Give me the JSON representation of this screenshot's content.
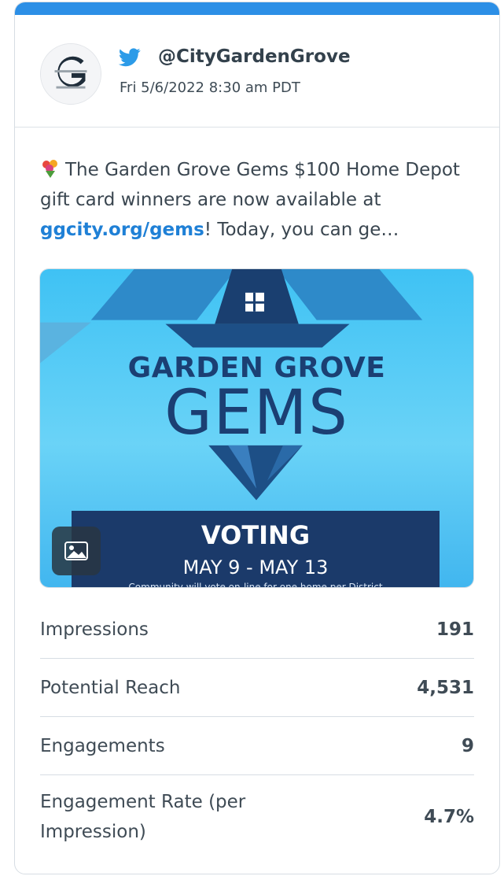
{
  "post": {
    "handle": "@CityGardenGrove",
    "timestamp": "Fri 5/6/2022 8:30 am PDT",
    "text_prefix": "The Garden Grove Gems $100 Home Depot gift card winners are now available at ",
    "link_text": "ggcity.org/gems",
    "text_suffix": "! Today, you can ge…",
    "emoji_icon": "bouquet-emoji-icon"
  },
  "avatar": {
    "logo_letter": "G",
    "logo_caption": "GARDEN GROVE"
  },
  "media": {
    "title_line1": "GARDEN GROVE",
    "title_line2": "GEMS",
    "voting_title": "VOTING",
    "voting_dates": "MAY 9 - MAY 13",
    "voting_note": "Community will vote on-line for one home per District",
    "badge_icon": "image-icon"
  },
  "metrics": [
    {
      "label": "Impressions",
      "value": "191"
    },
    {
      "label": "Potential Reach",
      "value": "4,531"
    },
    {
      "label": "Engagements",
      "value": "9"
    },
    {
      "label": "Engagement Rate (per Impression)",
      "value": "4.7%"
    }
  ],
  "colors": {
    "accent": "#2c8fe6",
    "link": "#1f80d6",
    "media_sky": "#4fc6f5",
    "gem_navy": "#1b3a6a"
  }
}
